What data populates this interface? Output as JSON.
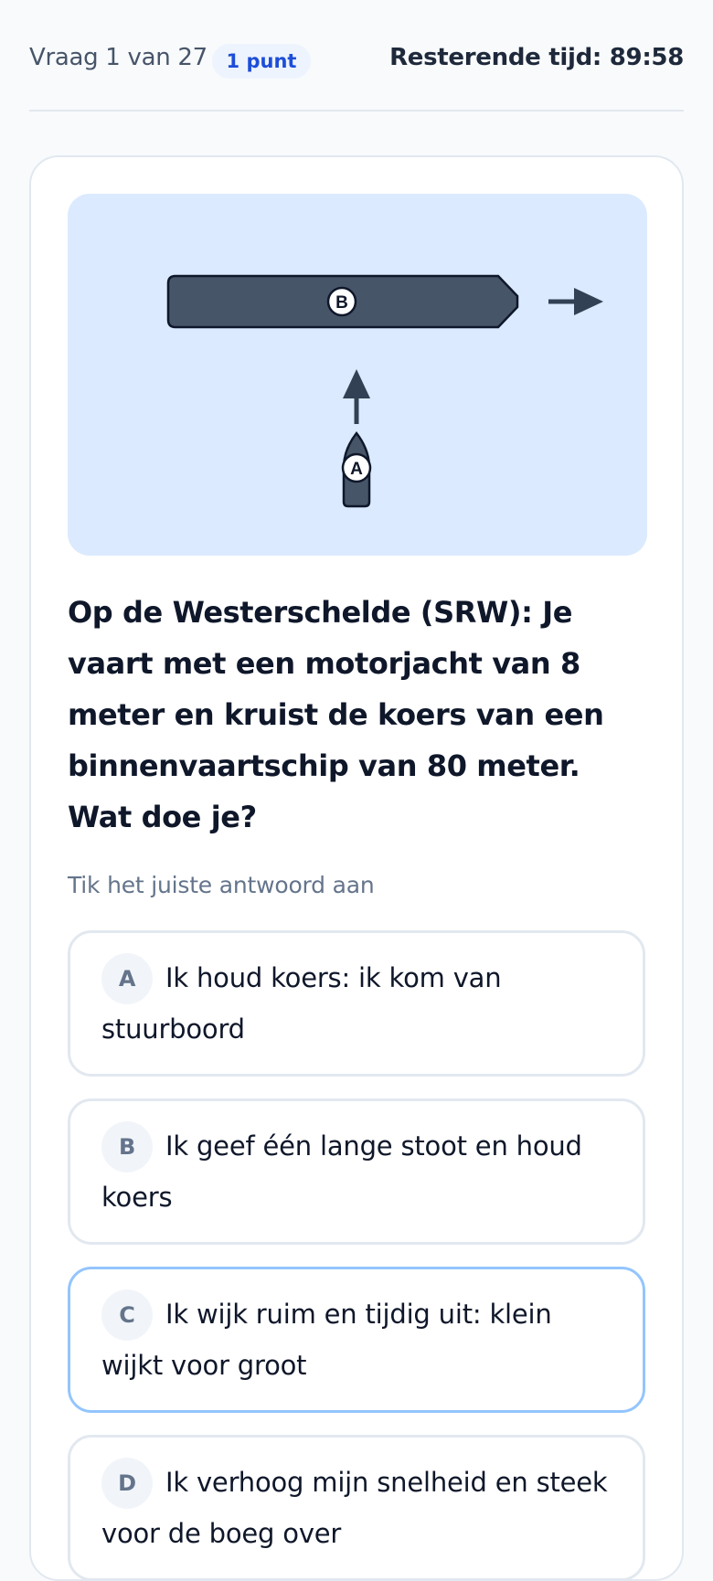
{
  "header": {
    "question_counter": "Vraag 1 van 27",
    "points_badge": "1 punt",
    "timer": "Resterende tijd: 89:58"
  },
  "illustration": {
    "ship_b_label": "B",
    "ship_a_label": "A",
    "water_color": "#dbeafe",
    "vessel_color": "#475569"
  },
  "question": {
    "text": "Op de Westerschelde (SRW): Je vaart met een motorjacht van 8 meter en kruist de koers van een binnenvaartschip van 80 meter. Wat doe je?",
    "hint": "Tik het juiste antwoord aan"
  },
  "options": [
    {
      "letter": "A",
      "text": "Ik houd koers: ik kom van stuurboord",
      "selected": false
    },
    {
      "letter": "B",
      "text": "Ik geef één lange stoot en houd koers",
      "selected": false
    },
    {
      "letter": "C",
      "text": "Ik wijk ruim en tijdig uit: klein wijkt voor groot",
      "selected": true
    },
    {
      "letter": "D",
      "text": "Ik verhoog mijn snelheid en steek voor de boeg over",
      "selected": false
    }
  ]
}
